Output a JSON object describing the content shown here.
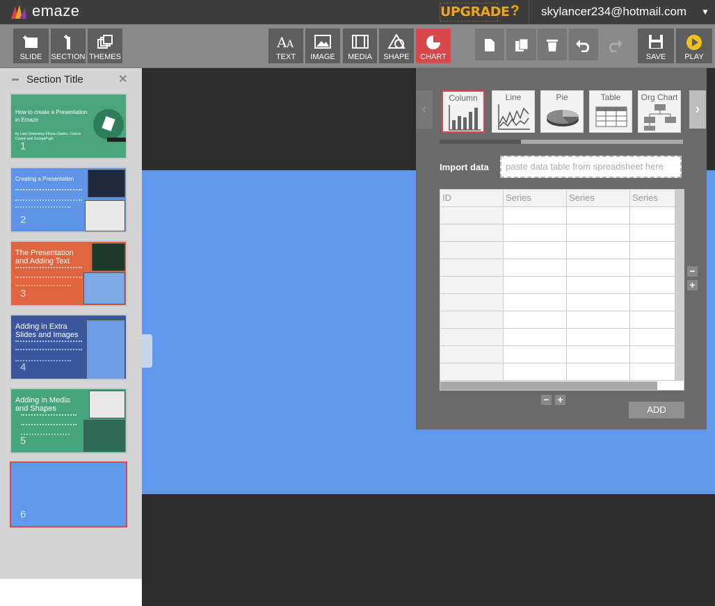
{
  "app": {
    "logo_text": "emaze",
    "upgrade_label": "UPGRADE",
    "help_label": "?",
    "user_email": "skylancer234@hotmail.com",
    "user_arrow": "▼"
  },
  "toolbar": {
    "left": [
      {
        "label": "SLIDE",
        "icon": "add-slide-icon"
      },
      {
        "label": "SECTION",
        "icon": "add-section-icon"
      },
      {
        "label": "THEMES",
        "icon": "themes-icon"
      }
    ],
    "insert": [
      {
        "label": "TEXT",
        "icon": "text-icon"
      },
      {
        "label": "IMAGE",
        "icon": "image-icon"
      },
      {
        "label": "MEDIA",
        "icon": "media-icon"
      },
      {
        "label": "SHAPE",
        "icon": "shape-icon"
      },
      {
        "label": "CHART",
        "icon": "chart-icon",
        "active": true
      }
    ],
    "edit_icons": [
      "new-page-icon",
      "duplicate-icon",
      "trash-icon",
      "undo-icon",
      "redo-icon"
    ],
    "save_label": "SAVE",
    "play_label": "PLAY"
  },
  "sidebar": {
    "section_title": "Section Title",
    "close_glyph": "✕",
    "slides": [
      {
        "num": "1",
        "title": "How to create a\nPresentation in Emaze",
        "subtitle": "by Liam Greenstey Ethcan Davies, Connor Caveni and GeorgePugh",
        "bg": "#4aa57f"
      },
      {
        "num": "2",
        "title": "Creating a Presentation",
        "bg": "#5f93e6"
      },
      {
        "num": "3",
        "title": "The Presentation and Adding Text",
        "bg": "#e0643e"
      },
      {
        "num": "4",
        "title": "Adding in Extra Slides and Images",
        "bg": "#3a57a0"
      },
      {
        "num": "5",
        "title": "Adding in Media and Shapes",
        "bg": "#46a57c"
      },
      {
        "num": "6",
        "title": "",
        "bg": "#6198ee"
      }
    ]
  },
  "chart_panel": {
    "types": [
      "Column",
      "Line",
      "Pie",
      "Table",
      "Org Chart"
    ],
    "selected": "Column",
    "import_label": "Import data",
    "import_placeholder": "paste data table from spreadsheet here",
    "grid_headers": [
      "ID",
      "Series",
      "Series",
      "Series"
    ],
    "grid_rows": 10,
    "add_label": "ADD",
    "minus": "−",
    "plus": "+"
  },
  "colors": {
    "accent": "#d9474a",
    "slide_bg": "#6198ee",
    "upgrade": "#f0a51f"
  }
}
